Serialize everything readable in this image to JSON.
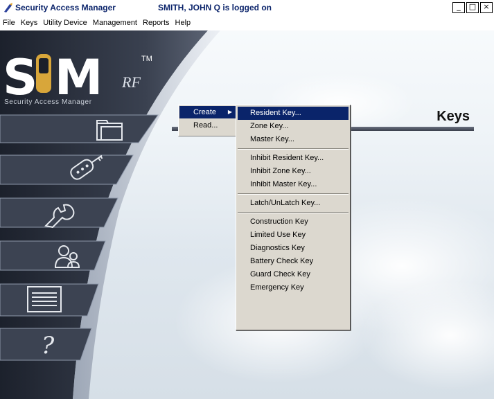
{
  "window": {
    "app_title": "Security Access Manager",
    "user_status": "SMITH, JOHN Q is logged on",
    "minimize": "_",
    "maximize": "□",
    "close": "×"
  },
  "menubar": [
    "File",
    "Keys",
    "Utility Device",
    "Management",
    "Reports",
    "Help"
  ],
  "logo": {
    "letters": "S M",
    "tm": "TM",
    "rf": "RF",
    "subtitle": "Security Access Manager"
  },
  "page": {
    "title": "Keys"
  },
  "context_menu": [
    {
      "label": "Create",
      "selected": true,
      "has_submenu": true
    },
    {
      "label": "Read...",
      "selected": false
    }
  ],
  "submenu": {
    "group1": [
      "Resident Key...",
      "Zone Key...",
      "Master Key..."
    ],
    "group2": [
      "Inhibit Resident Key...",
      "Inhibit Zone Key...",
      "Inhibit Master Key..."
    ],
    "group3": [
      "Latch/UnLatch Key..."
    ],
    "group4": [
      "Construction Key",
      "Limited Use Key",
      "Diagnostics Key",
      "Battery Check Key",
      "Guard Check Key",
      "Emergency Key"
    ]
  },
  "nav_icons": [
    "folder-icon",
    "key-fob-icon",
    "wrench-icon",
    "users-icon",
    "list-icon",
    "help-icon"
  ],
  "colors": {
    "selection": "#0a246a",
    "menu_bg": "#dcd8cf",
    "sidebar": "#2e3442"
  }
}
